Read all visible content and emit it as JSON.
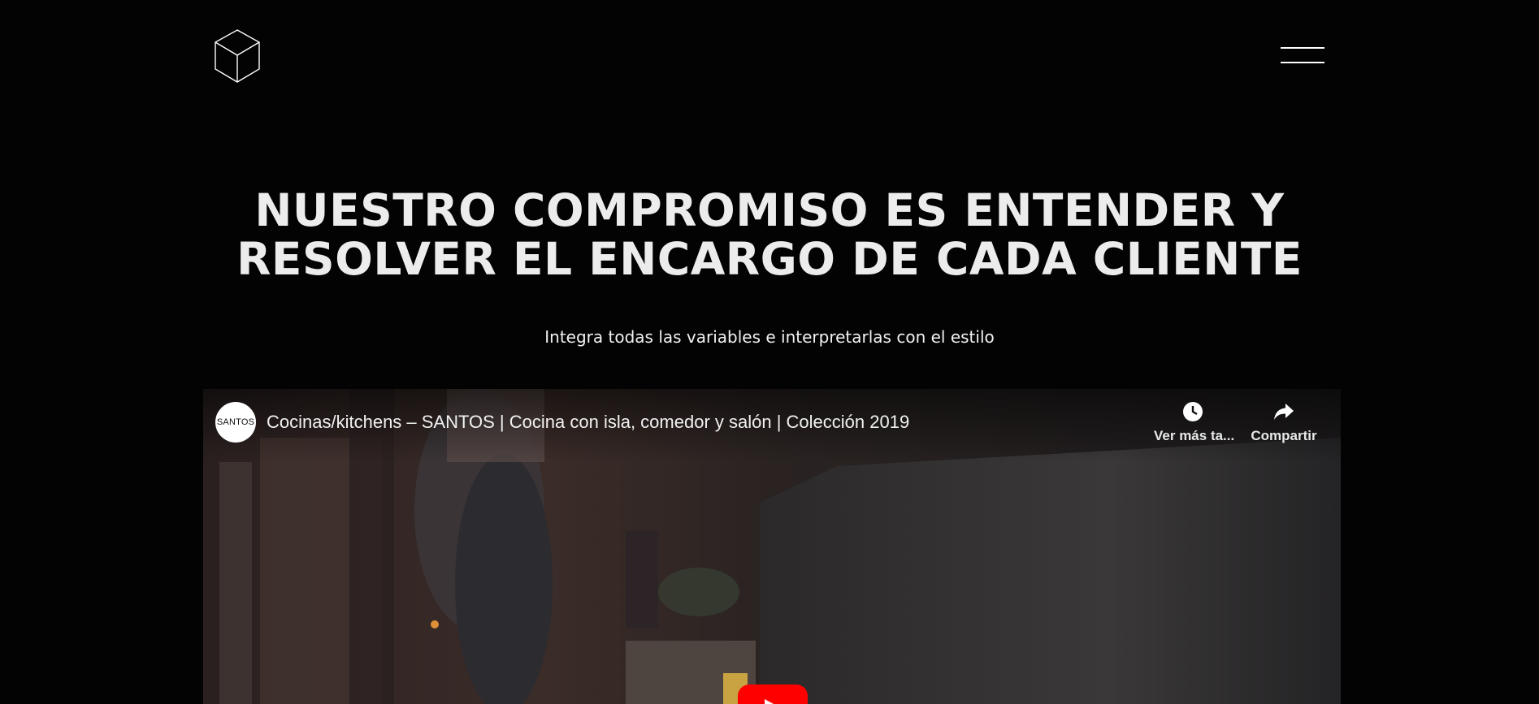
{
  "header": {
    "logo_icon": "cube-icon",
    "menu_icon": "hamburger-menu-icon"
  },
  "hero": {
    "headline_line1": "NUESTRO COMPROMISO ES ENTENDER Y",
    "headline_line2": "RESOLVER EL ENCARGO DE CADA CLIENTE",
    "subtitle": "Integra todas las variables e interpretarlas con el estilo"
  },
  "video": {
    "channel_avatar_text": "SANTOS",
    "title": "Cocinas/kitchens – SANTOS | Cocina con isla, comedor y salón | Colección 2019",
    "watch_later_label": "Ver más ta...",
    "watch_later_icon": "clock-icon",
    "share_label": "Compartir",
    "share_icon": "share-arrow-icon",
    "play_icon": "youtube-play-icon"
  },
  "colors": {
    "background": "#030304",
    "headline": "#ececec",
    "play_button": "#ff0000"
  }
}
